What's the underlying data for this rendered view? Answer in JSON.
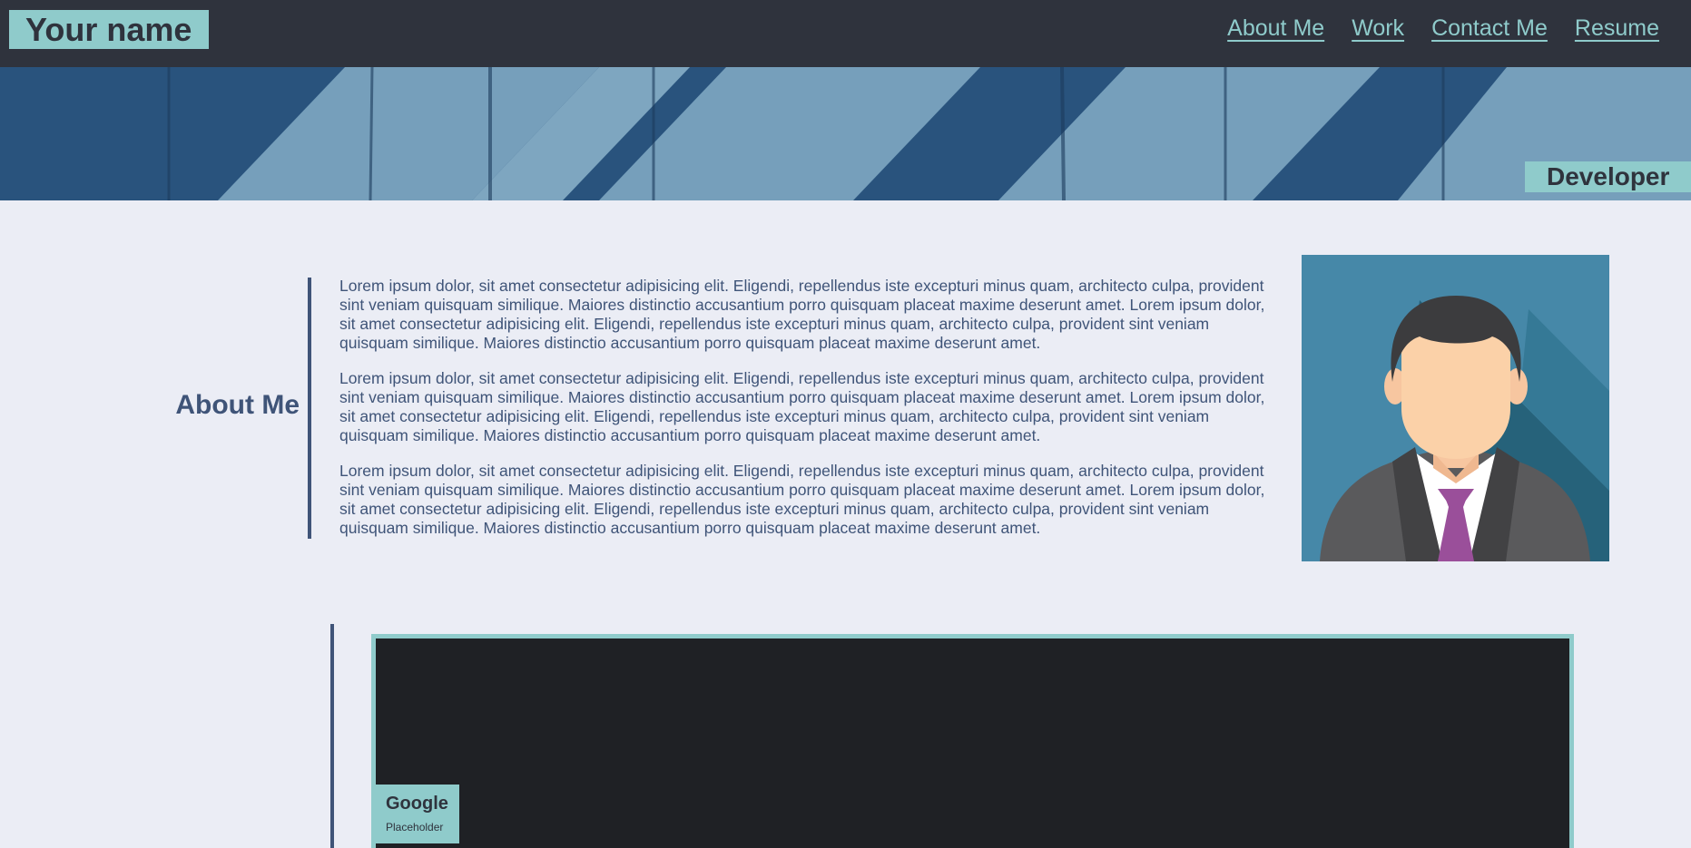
{
  "header": {
    "brand": "Your name",
    "nav": [
      "About Me",
      "Work",
      "Contact Me",
      "Resume"
    ]
  },
  "banner": {
    "role": "Developer"
  },
  "about": {
    "title": "About Me",
    "paragraphs": [
      "Lorem ipsum dolor, sit amet consectetur adipisicing elit. Eligendi, repellendus iste excepturi minus quam, architecto culpa, provident sint veniam quisquam similique. Maiores distinctio accusantium porro quisquam placeat maxime deserunt amet. Lorem ipsum dolor, sit amet consectetur adipisicing elit. Eligendi, repellendus iste excepturi minus quam, architecto culpa, provident sint veniam quisquam similique. Maiores distinctio accusantium porro quisquam placeat maxime deserunt amet.",
      "Lorem ipsum dolor, sit amet consectetur adipisicing elit. Eligendi, repellendus iste excepturi minus quam, architecto culpa, provident sint veniam quisquam similique. Maiores distinctio accusantium porro quisquam placeat maxime deserunt amet. Lorem ipsum dolor, sit amet consectetur adipisicing elit. Eligendi, repellendus iste excepturi minus quam, architecto culpa, provident sint veniam quisquam similique. Maiores distinctio accusantium porro quisquam placeat maxime deserunt amet.",
      "Lorem ipsum dolor, sit amet consectetur adipisicing elit. Eligendi, repellendus iste excepturi minus quam, architecto culpa, provident sint veniam quisquam similique. Maiores distinctio accusantium porro quisquam placeat maxime deserunt amet. Lorem ipsum dolor, sit amet consectetur adipisicing elit. Eligendi, repellendus iste excepturi minus quam, architecto culpa, provident sint veniam quisquam similique. Maiores distinctio accusantium porro quisquam placeat maxime deserunt amet."
    ]
  },
  "work": {
    "card_title": "Google",
    "card_subtitle": "Placeholder"
  },
  "colors": {
    "header_bg": "#2f333d",
    "accent": "#8fcbcb",
    "text": "#3f5478",
    "page_bg": "#ebedf5",
    "card_bg": "#1f2125"
  }
}
